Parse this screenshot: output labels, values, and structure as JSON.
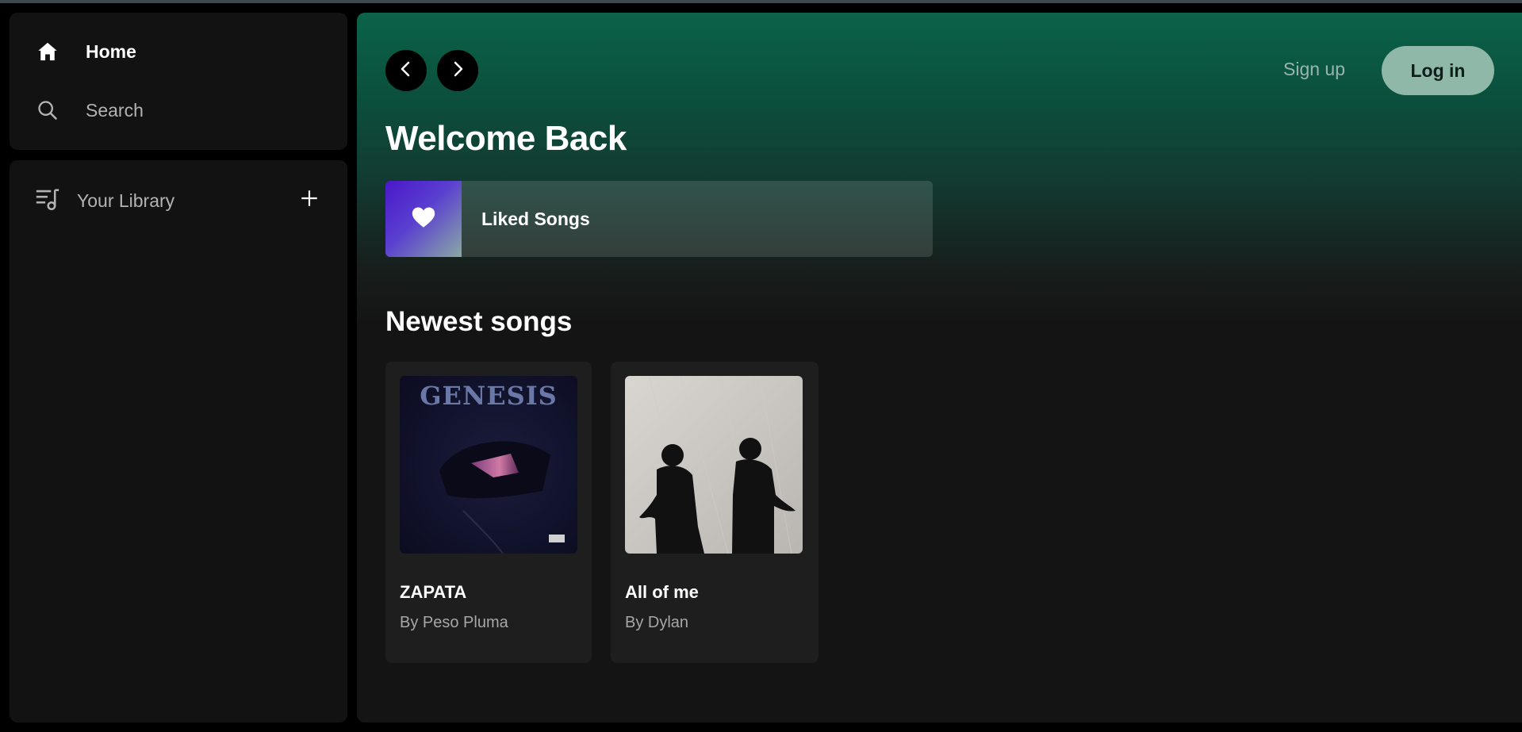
{
  "sidebar": {
    "nav": [
      {
        "label": "Home",
        "icon": "home-icon"
      },
      {
        "label": "Search",
        "icon": "search-icon"
      }
    ],
    "library": {
      "label": "Your Library",
      "icon": "library-icon",
      "add_icon": "plus-icon"
    }
  },
  "header": {
    "back_icon": "chevron-left-icon",
    "forward_icon": "chevron-right-icon",
    "signup_label": "Sign up",
    "login_label": "Log in"
  },
  "main": {
    "welcome": "Welcome Back",
    "liked_songs": {
      "label": "Liked Songs",
      "icon": "heart-icon"
    },
    "newest_title": "Newest songs",
    "songs": [
      {
        "title": "ZAPATA",
        "artist": "By Peso Pluma",
        "cover_text": "GENESIS"
      },
      {
        "title": "All of me",
        "artist": "By Dylan"
      }
    ]
  },
  "colors": {
    "accent_green": "#0b6349",
    "login_bg": "#8fb8a9",
    "panel_bg": "#121212"
  }
}
